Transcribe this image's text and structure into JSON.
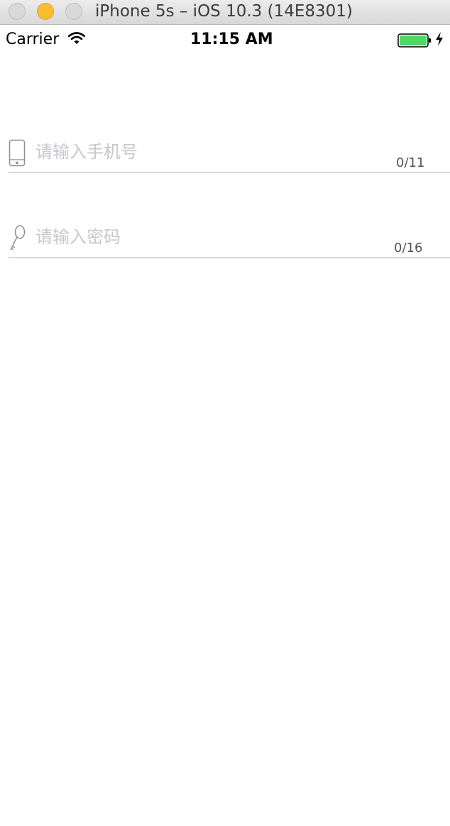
{
  "window": {
    "title": "iPhone 5s – iOS 10.3 (14E8301)"
  },
  "status_bar": {
    "carrier": "Carrier",
    "time": "11:15 AM",
    "battery_color": "#4cd964"
  },
  "form": {
    "phone": {
      "placeholder": "请输入手机号",
      "counter": "0/11",
      "icon": "phone-icon"
    },
    "password": {
      "placeholder": "请输入密码",
      "counter": "0/16",
      "icon": "key-icon"
    }
  }
}
